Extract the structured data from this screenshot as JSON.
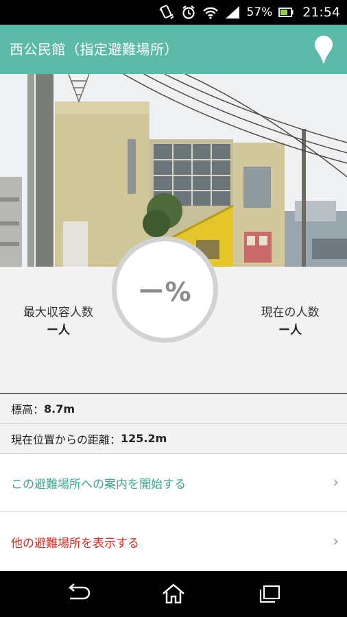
{
  "status_bar": {
    "battery_percent": "57%",
    "time": "21:54"
  },
  "app_bar": {
    "title": "西公民館（指定避難場所）"
  },
  "stats": {
    "max_capacity_label": "最大収容人数",
    "max_capacity_value": "ー人",
    "current_count_label": "現在の人数",
    "current_count_value": "ー人",
    "occupancy_percent": "ー%"
  },
  "info": {
    "elevation_label": "標高：",
    "elevation_value": "8.7m",
    "distance_label": "現在位置からの距離：",
    "distance_value": "125.2m"
  },
  "actions": {
    "start_guidance": "この避難場所への案内を開始する",
    "show_other_shelters": "他の避難場所を表示する"
  },
  "colors": {
    "accent_teal": "#5bbba8",
    "link_teal": "#3aa88f",
    "link_red": "#e8261e"
  }
}
